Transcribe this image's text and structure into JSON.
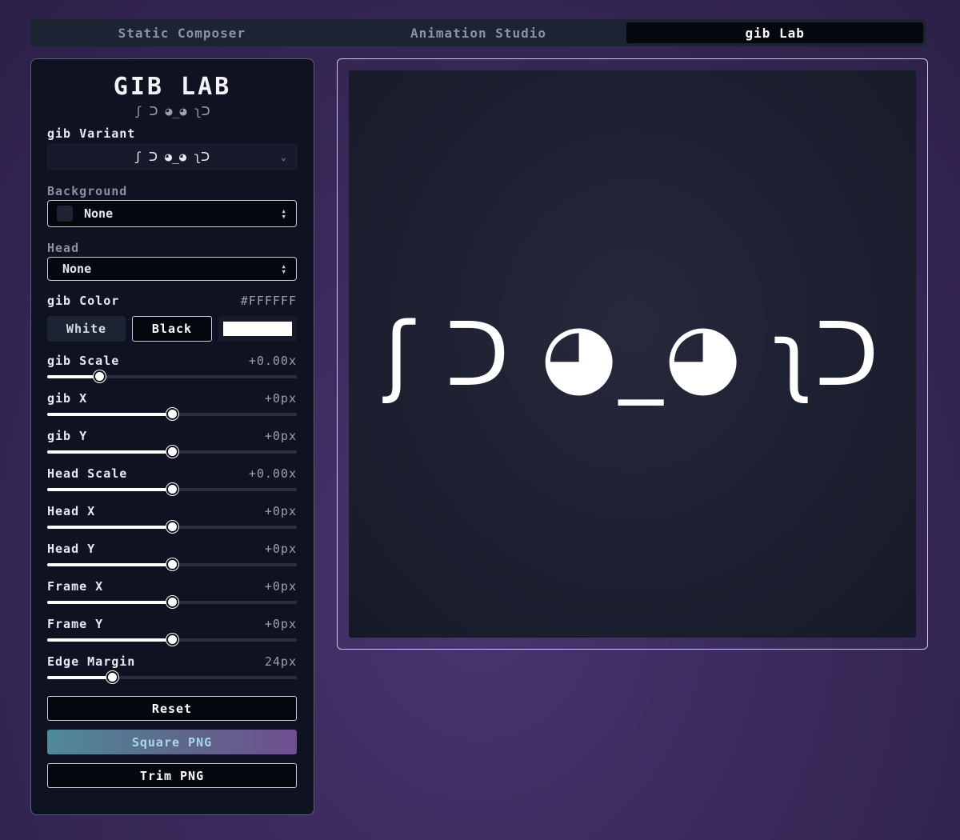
{
  "tabs": [
    {
      "label": "Static Composer",
      "active": false
    },
    {
      "label": "Animation Studio",
      "active": false
    },
    {
      "label": "gib Lab",
      "active": true
    }
  ],
  "sidebar": {
    "title": "GIB LAB",
    "subtitle": "ʃ ᑐ ◕_◕ ʅᑐ",
    "variant": {
      "label": "gib Variant",
      "value": "ʃ ᑐ ◕_◕ ʅᑐ"
    },
    "background": {
      "label": "Background",
      "value": "None"
    },
    "head": {
      "label": "Head",
      "value": "None"
    },
    "gib_color": {
      "label": "gib Color",
      "hex": "#FFFFFF",
      "white_label": "White",
      "black_label": "Black",
      "swatch": "#ffffff"
    },
    "sliders": [
      {
        "label": "gib Scale",
        "value": "+0.00x",
        "level": 0.21
      },
      {
        "label": "gib X",
        "value": "+0px",
        "level": 0.5
      },
      {
        "label": "gib Y",
        "value": "+0px",
        "level": 0.5
      },
      {
        "label": "Head Scale",
        "value": "+0.00x",
        "level": 0.5
      },
      {
        "label": "Head X",
        "value": "+0px",
        "level": 0.5
      },
      {
        "label": "Head Y",
        "value": "+0px",
        "level": 0.5
      },
      {
        "label": "Frame X",
        "value": "+0px",
        "level": 0.5
      },
      {
        "label": "Frame Y",
        "value": "+0px",
        "level": 0.5
      },
      {
        "label": "Edge Margin",
        "value": "24px",
        "level": 0.26
      }
    ],
    "buttons": {
      "reset": "Reset",
      "square_png": "Square PNG",
      "trim_png": "Trim PNG"
    }
  },
  "preview": {
    "gib_text": "ʃ ᑐ ◕_◕ ʅᑐ"
  }
}
